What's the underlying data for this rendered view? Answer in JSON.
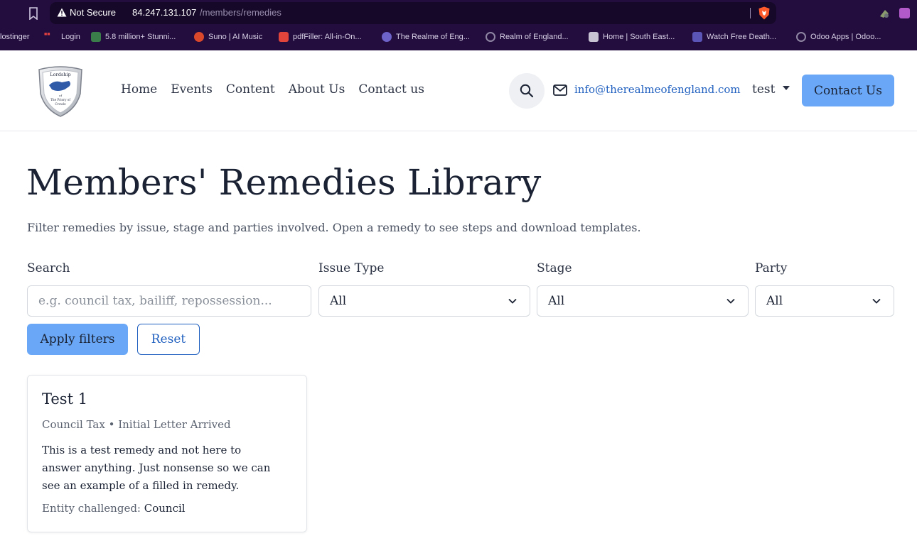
{
  "browser": {
    "security_label": "Not Secure",
    "url_host": "84.247.131.107",
    "url_path": "/members/remedies",
    "bookmarks": [
      {
        "label": "lostinger",
        "icon": "none"
      },
      {
        "label": "Login",
        "icon": "login-icon"
      },
      {
        "label": "5.8 million+ Stunni...",
        "icon": "px-icon"
      },
      {
        "label": "Suno | AI Music",
        "icon": "suno-icon"
      },
      {
        "label": "pdfFiller: All-in-On...",
        "icon": "pdffiller-icon"
      },
      {
        "label": "The Realme of Eng...",
        "icon": "shield-icon"
      },
      {
        "label": "Realm of England...",
        "icon": "globe-icon"
      },
      {
        "label": "Home | South East...",
        "icon": "page-icon"
      },
      {
        "label": "Watch Free Death...",
        "icon": "play-icon"
      },
      {
        "label": "Odoo Apps | Odoo...",
        "icon": "globe-icon"
      }
    ]
  },
  "header": {
    "logo_text": [
      "Lordship",
      "of",
      "The Priory of",
      "Crowle"
    ],
    "nav": [
      "Home",
      "Events",
      "Content",
      "About Us",
      "Contact us"
    ],
    "email": "info@therealmeofengland.com",
    "user": "test",
    "contact_button": "Contact Us"
  },
  "main": {
    "title": "Members' Remedies Library",
    "subtitle": "Filter remedies by issue, stage and parties involved. Open a remedy to see steps and download templates.",
    "filters": {
      "search_label": "Search",
      "search_placeholder": "e.g. council tax, bailiff, repossession...",
      "issue_label": "Issue Type",
      "issue_value": "All",
      "stage_label": "Stage",
      "stage_value": "All",
      "party_label": "Party",
      "party_value": "All",
      "apply": "Apply filters",
      "reset": "Reset"
    },
    "remedies": [
      {
        "title": "Test 1",
        "meta": "Council Tax • Initial Letter Arrived",
        "description": "This is a test remedy and not here to answer anything. Just nonsense so we can see an example of a filled in remedy.",
        "entity_label": "Entity challenged:",
        "entity_value": "Council"
      }
    ]
  },
  "colors": {
    "chrome_bg": "#230d3f",
    "accent_button": "#6aa8f7",
    "link": "#1f5fbf"
  }
}
